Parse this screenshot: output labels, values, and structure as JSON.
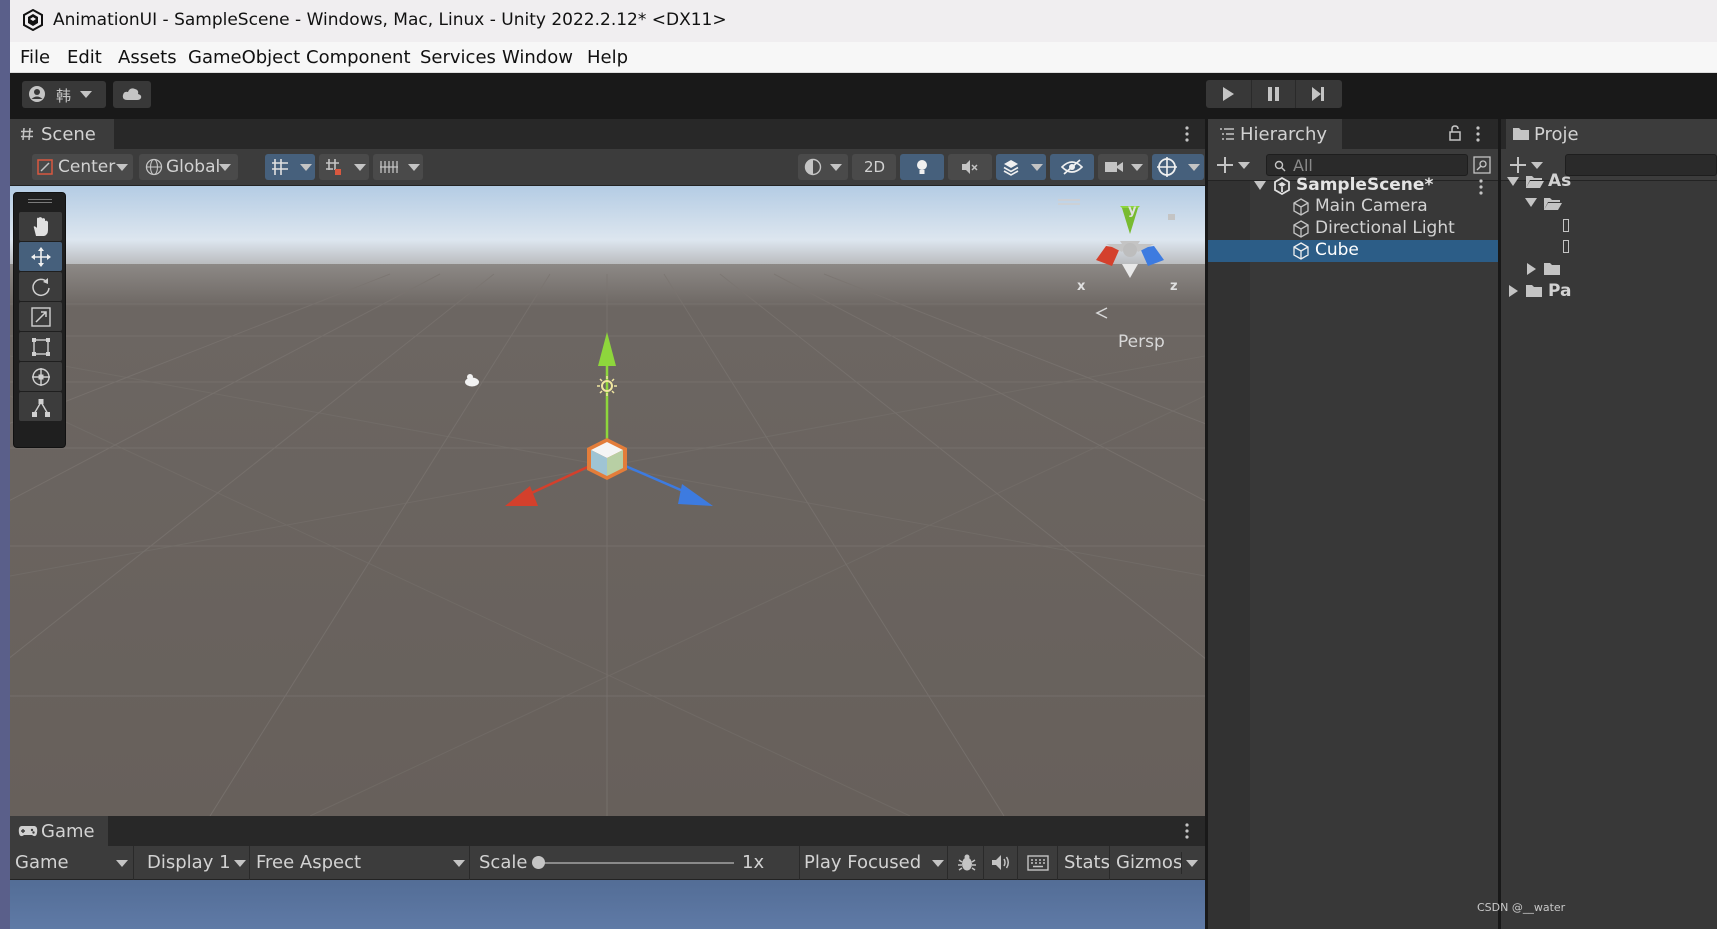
{
  "window": {
    "title": "AnimationUI - SampleScene - Windows, Mac, Linux - Unity 2022.2.12* <DX11>"
  },
  "menu": [
    "File",
    "Edit",
    "Assets",
    "GameObject",
    "Component",
    "Services",
    "Window",
    "Help"
  ],
  "toolbar": {
    "account_label": "韩"
  },
  "scene": {
    "tab_label": "Scene",
    "pivot_label": "Center",
    "space_label": "Global",
    "mode_2d_label": "2D",
    "persp_label": "Persp",
    "axis_x": "x",
    "axis_y": "y",
    "axis_z": "z"
  },
  "game": {
    "tab_label": "Game",
    "view_select": "Game",
    "display_select": "Display 1",
    "aspect_select": "Free Aspect",
    "scale_label": "Scale",
    "scale_value": "1x",
    "scale_fraction": 0,
    "play_mode_select": "Play Focused",
    "stats_label": "Stats",
    "gizmos_label": "Gizmos"
  },
  "hierarchy": {
    "tab_label": "Hierarchy",
    "search_placeholder": "All",
    "scene_name": "SampleScene*",
    "items": [
      "Main Camera",
      "Directional Light",
      "Cube"
    ],
    "selected": "Cube"
  },
  "project": {
    "tab_label": "Proje",
    "rows": [
      "As",
      "Pa"
    ]
  },
  "watermark": "CSDN @__water",
  "colors": {
    "selection": "#2c5d87",
    "active_tool": "#46607c",
    "axis_x": "#d4402c",
    "axis_y": "#8ed63c",
    "axis_z": "#3d7be0"
  }
}
